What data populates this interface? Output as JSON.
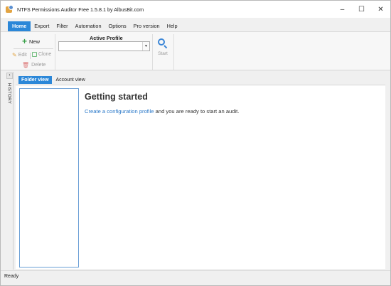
{
  "window": {
    "title": "NTFS Permissions Auditor Free 1.5.8.1 by AlbusBit.com",
    "controls": {
      "minimize": "–",
      "maximize": "☐",
      "close": "✕"
    }
  },
  "menu": {
    "items": [
      "Home",
      "Export",
      "Filter",
      "Automation",
      "Options",
      "Pro version",
      "Help"
    ],
    "active_index": 0
  },
  "ribbon": {
    "new_label": "New",
    "edit_label": "Edit",
    "clone_label": "Clone",
    "delete_label": "Delete",
    "active_profile_label": "Active Profile",
    "active_profile_value": "",
    "start_label": "Start"
  },
  "history": {
    "toggle": "›",
    "label": "HISTORY"
  },
  "tabs": {
    "items": [
      "Folder view",
      "Account view"
    ],
    "active_index": 0
  },
  "main": {
    "heading": "Getting started",
    "intro_link": "Create a configuration profile",
    "intro_rest": " and you are ready to start an audit."
  },
  "status": {
    "text": "Ready"
  },
  "colors": {
    "accent": "#2b87d8",
    "link": "#2b79c9",
    "new_icon": "#3aa14a"
  },
  "icons": {
    "new": "plus-icon",
    "edit": "pencil-icon",
    "clone": "clone-icon",
    "delete": "trash-icon",
    "start": "search-icon"
  }
}
